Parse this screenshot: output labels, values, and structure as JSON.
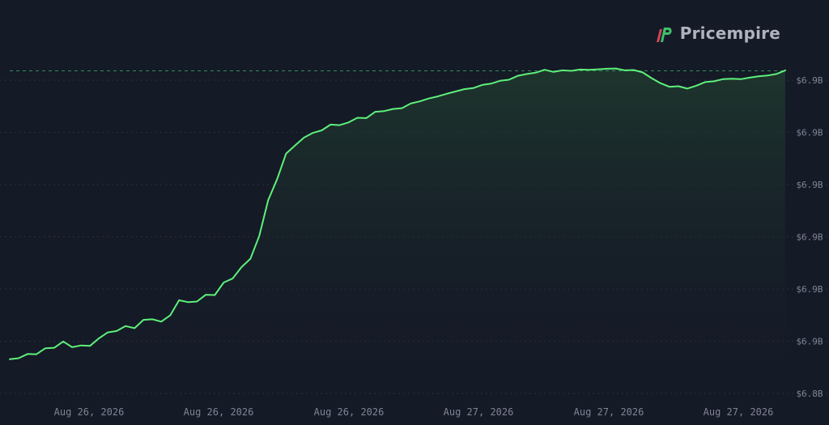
{
  "brand": {
    "name": "Pricempire",
    "logo_icon": "pricempire-logo-icon"
  },
  "colors": {
    "background": "#151a27",
    "line": "#5ef07a",
    "fill_top": "#1f3a2e",
    "reference_line": "#2f8f58",
    "grid": "#283041",
    "tick_text": "#7f8594",
    "logo_green": "#3fbf6a",
    "logo_red": "#d6455a"
  },
  "chart_data": {
    "type": "area",
    "title": "",
    "xlabel": "",
    "ylabel": "",
    "x_tick_labels": [
      "Aug 26, 2026",
      "Aug 26, 2026",
      "Aug 26, 2026",
      "Aug 27, 2026",
      "Aug 27, 2026",
      "Aug 27, 2026"
    ],
    "y_tick_labels": [
      "$6.9B",
      "$6.9B",
      "$6.9B",
      "$6.9B",
      "$6.9B",
      "$6.9B",
      "$6.8B"
    ],
    "y_tick_values": [
      6.9,
      6.88,
      6.86,
      6.84,
      6.82,
      6.8,
      6.78
    ],
    "ylim": [
      6.78,
      6.905
    ],
    "grid": "horizontal-dashed",
    "reference_line_value": 6.9036,
    "series": [
      {
        "values": [
          6.7931,
          6.7935,
          6.7951,
          6.795,
          6.7973,
          6.7975,
          6.7999,
          6.7977,
          6.7984,
          6.7982,
          6.8011,
          6.8034,
          6.8039,
          6.8058,
          6.805,
          6.8082,
          6.8084,
          6.8075,
          6.8099,
          6.8157,
          6.815,
          6.8152,
          6.8178,
          6.8177,
          6.8225,
          6.824,
          6.8284,
          6.8316,
          6.8404,
          6.8541,
          6.8621,
          6.8719,
          6.875,
          6.878,
          6.8798,
          6.8808,
          6.883,
          6.8828,
          6.8838,
          6.8856,
          6.8855,
          6.8879,
          6.8882,
          6.889,
          6.8893,
          6.8911,
          6.8919,
          6.893,
          6.8938,
          6.8948,
          6.8957,
          6.8966,
          6.897,
          6.8982,
          6.8987,
          6.8998,
          6.9002,
          6.9017,
          6.9024,
          6.9029,
          6.904,
          6.9032,
          6.9038,
          6.9036,
          6.9041,
          6.904,
          6.9042,
          6.9044,
          6.9045,
          6.9038,
          6.9039,
          6.903,
          6.9008,
          6.8989,
          6.8975,
          6.8977,
          6.8968,
          6.8979,
          6.8993,
          6.8996,
          6.9004,
          6.9006,
          6.9004,
          6.901,
          6.9015,
          6.9018,
          6.9024,
          6.9038
        ]
      }
    ]
  }
}
